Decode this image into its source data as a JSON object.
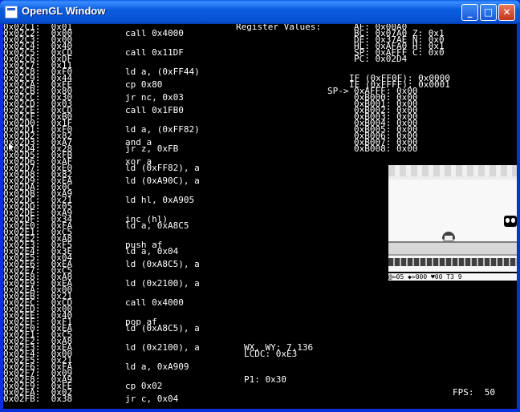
{
  "window": {
    "title": "OpenGL Window",
    "controls": {
      "minimize": "_",
      "maximize": "□",
      "close": "✕"
    }
  },
  "disassembly": {
    "addresses": [
      "0x02C1:  0x01",
      "0x02C2:  0x00",
      "0x02C3:  0x00",
      "0x02C4:  0x40",
      "0x02C5:  0xCD",
      "0x02C6:  0xDF",
      "0x02C7:  0x11",
      "0x02C8:  0xF0",
      "0x02C9:  0x44",
      "0x02CA:  0xFE",
      "0x02CB:  0x80",
      "0x02CC:  0x30",
      "0x02CD:  0x03",
      "0x02CE:  0xCD",
      "0x02CF:  0xB0",
      "0x02D0:  0x1F",
      "0x02D1:  0xF0",
      "0x02D2:  0x82",
      "0x02D3:  0xA7",
      "0x02D4:  0x28",
      "0x02D5:  0xFB",
      "0x02D6:  0xAF",
      "0x02D7:  0xE0",
      "0x02D8:  0x82",
      "0x02D9:  0xEA",
      "0x02DA:  0x0C",
      "0x02DB:  0xA9",
      "0x02DC:  0x21",
      "0x02DD:  0x05",
      "0x02DE:  0xA9",
      "0x02DF:  0x34",
      "0x02E0:  0xFA",
      "0x02E1:  0xC5",
      "0x02E2:  0xA8",
      "0x02E3:  0xF5",
      "0x02E4:  0x3E",
      "0x02E5:  0x04",
      "0x02E6:  0xEA",
      "0x02E7:  0xC5",
      "0x02E8:  0xA8",
      "0x02E9:  0xEA",
      "0x02EA:  0x00",
      "0x02EB:  0x21",
      "0x02EC:  0xCD",
      "0x02ED:  0x00",
      "0x02EE:  0x40",
      "0x02EF:  0xF1",
      "0x02F0:  0xEA",
      "0x02F1:  0xC5",
      "0x02F2:  0xA8",
      "0x02F3:  0xEA",
      "0x02F4:  0x00",
      "0x02F5:  0x21",
      "0x02F6:  0xFA",
      "0x02F7:  0x09",
      "0x02F8:  0xA9",
      "0x02F9:  0xFE",
      "0x02FA:  0x02",
      "0x02FB:  0x38"
    ],
    "instructions": [
      "",
      "call 0x4000",
      "",
      "",
      "call 0x11DF",
      "",
      "",
      "ld a, (0xFF44)",
      "",
      "cp 0x80",
      "",
      "jr nc, 0x03",
      "",
      "call 0x1FB0",
      "",
      "",
      "ld a, (0xFF82)",
      "",
      "and a",
      "jr z, 0xFB",
      "",
      "xor a",
      "ld (0xFF82), a",
      "",
      "ld (0xA90C), a",
      "",
      "",
      "ld hl, 0xA905",
      "",
      "",
      "inc (hl)",
      "ld a, 0xA8C5",
      "",
      "",
      "push af",
      "ld a, 0x04",
      "",
      "ld (0xA8C5), a",
      "",
      "",
      "ld (0x2100), a",
      "",
      "",
      "call 0x4000",
      "",
      "",
      "pop af",
      "ld (0xA8C5), a",
      "",
      "",
      "ld (0x2100), a",
      "",
      "",
      "ld a, 0xA909",
      "",
      "",
      "cp 0x02",
      "",
      "jr c, 0x04"
    ],
    "current_marker": "▶"
  },
  "registers": {
    "heading": "Register Values:",
    "lines": [
      "AF: 0x00A0",
      "BC: 0x07A0 Z: 0x1",
      "DE: 0x37AE N: 0x0",
      "HL: 0xAFA0 H: 0x1",
      "SP: 0xAFFF C: 0x0",
      "PC: 0x02D4"
    ],
    "interrupt_lines": [
      "IF (0xFF0F): 0x0000",
      "IE (0xFFFF): 0x0001"
    ]
  },
  "stack": {
    "pointer_label": "SP->",
    "lines": [
      "0xAFFF: 0x00",
      "0xB000: 0x00",
      "0xB001: 0x00",
      "0xB002: 0x00",
      "0xB003: 0x00",
      "0xB004: 0x00",
      "0xB005: 0x00",
      "0xB006: 0x00",
      "0xB007: 0x00",
      "0xB008: 0x00"
    ]
  },
  "lcd": {
    "wx_wy": "WX, WY: 7,136",
    "lcdc": "LCDC: 0xE3",
    "p1": "P1: 0x30",
    "fps": "FPS:  50"
  },
  "game_screen": {
    "hud_text": "@=05 ◆=000 ♥00 T3 9"
  },
  "colors": {
    "background": "#000000",
    "text": "#ffffff",
    "titlebar": "#0b5ce0",
    "close_button": "#c2351b"
  }
}
